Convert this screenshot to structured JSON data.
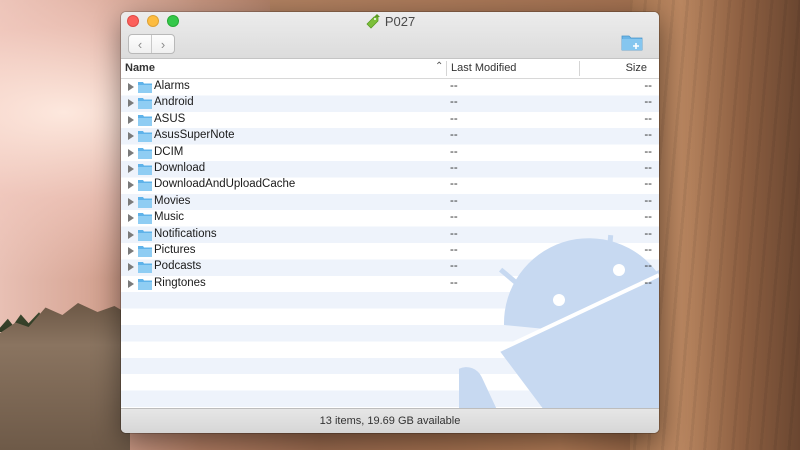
{
  "window": {
    "title": "P027"
  },
  "toolbar": {
    "back_glyph": "‹",
    "forward_glyph": "›",
    "new_folder_icon": "folder-plus-icon"
  },
  "columns": {
    "name": "Name",
    "modified": "Last Modified",
    "size": "Size"
  },
  "files": [
    {
      "name": "Alarms",
      "modified": "--",
      "size": "--"
    },
    {
      "name": "Android",
      "modified": "--",
      "size": "--"
    },
    {
      "name": "ASUS",
      "modified": "--",
      "size": "--"
    },
    {
      "name": "AsusSuperNote",
      "modified": "--",
      "size": "--"
    },
    {
      "name": "DCIM",
      "modified": "--",
      "size": "--"
    },
    {
      "name": "Download",
      "modified": "--",
      "size": "--"
    },
    {
      "name": "DownloadAndUploadCache",
      "modified": "--",
      "size": "--"
    },
    {
      "name": "Movies",
      "modified": "--",
      "size": "--"
    },
    {
      "name": "Music",
      "modified": "--",
      "size": "--"
    },
    {
      "name": "Notifications",
      "modified": "--",
      "size": "--"
    },
    {
      "name": "Pictures",
      "modified": "--",
      "size": "--"
    },
    {
      "name": "Podcasts",
      "modified": "--",
      "size": "--"
    },
    {
      "name": "Ringtones",
      "modified": "--",
      "size": "--"
    }
  ],
  "status": {
    "text": "13 items, 19.69 GB available"
  },
  "colors": {
    "folder": "#5fb3ea",
    "folder_tab": "#8fcdf3",
    "android_watermark": "#c7d9f1",
    "row_alt": "#eef3fb",
    "title_icon": "#7cbf3a"
  }
}
